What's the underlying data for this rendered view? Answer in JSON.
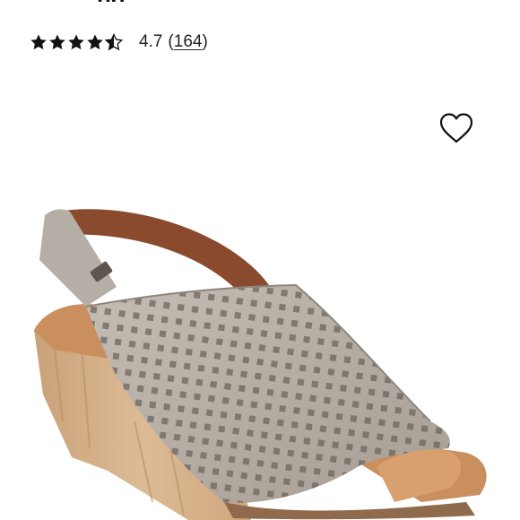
{
  "product": {
    "title_fragment": "ng",
    "rating": {
      "stars": 4.5,
      "value": "4.7",
      "count_open": "(",
      "count": "164",
      "count_close": ")"
    },
    "image_description": "product-photo-wedge-sandal",
    "colors": {
      "upper": "#b3aba2",
      "cork": "#d7b48e",
      "lining": "#8a4a2e",
      "footbed": "#c98f5f"
    }
  },
  "icons": {
    "wishlist": "heart-outline-icon",
    "star_full": "star-filled-icon",
    "star_half": "star-half-icon"
  }
}
